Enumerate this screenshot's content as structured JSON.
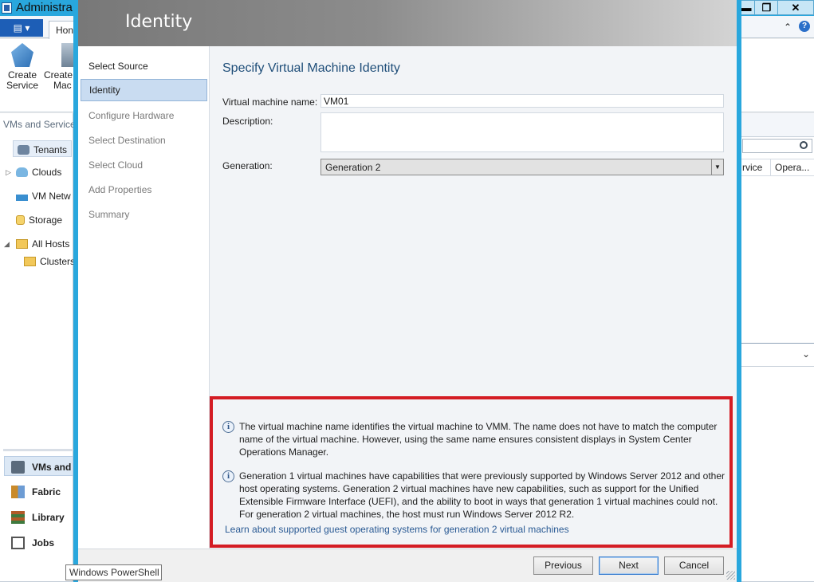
{
  "main_window": {
    "title": "Administra",
    "window_buttons": {
      "minimize": "▬",
      "restore": "❐",
      "close": "✕"
    },
    "file_menu": "▤ ▾",
    "tab_home": "Hon",
    "ribbon_collapse": "⌃",
    "ribbon_help": "?",
    "ribbon_buttons": {
      "create_service": [
        "Create",
        "Service"
      ],
      "create_vm": [
        "Create",
        "Mac"
      ]
    },
    "nav": {
      "header": "VMs and Service",
      "items": {
        "tenants": "Tenants",
        "clouds": "Clouds",
        "vm_networks": "VM Netw",
        "storage": "Storage",
        "all_hosts": "All Hosts",
        "clusters": "Clusters"
      },
      "workspaces": {
        "vms": "VMs and",
        "fabric": "Fabric",
        "library": "Library",
        "jobs": "Jobs"
      }
    },
    "grid_columns": {
      "service": "rvice",
      "operating": "Opera..."
    }
  },
  "wizard": {
    "header_title": "Identity",
    "steps": [
      {
        "label": "Select Source"
      },
      {
        "label": "Identity"
      },
      {
        "label": "Configure Hardware"
      },
      {
        "label": "Select Destination"
      },
      {
        "label": "Select Cloud"
      },
      {
        "label": "Add Properties"
      },
      {
        "label": "Summary"
      }
    ],
    "page_title": "Specify Virtual Machine Identity",
    "fields": {
      "vm_name_label": "Virtual machine name:",
      "vm_name_value": "VM01",
      "description_label": "Description:",
      "description_value": "",
      "generation_label": "Generation:",
      "generation_value": "Generation 2"
    },
    "info": {
      "icon": "i",
      "para1_lines": [
        "The virtual machine name identifies the virtual machine to VMM. The name does not have to match the computer",
        "name of the virtual machine. However, using the same name ensures consistent displays in System Center",
        "Operations Manager."
      ],
      "para2_lines": [
        "Generation 1 virtual machines have capabilities that were previously supported by Windows Server 2012 and other",
        "host operating systems. Generation 2 virtual machines have new capabilities, such as support for the Unified",
        "Extensible Firmware Interface (UEFI), and the ability to boot in ways that generation 1 virtual machines could not.",
        "For generation 2 virtual machines, the host must run Windows Server 2012 R2."
      ],
      "link": "Learn about supported guest operating systems for generation 2 virtual machines"
    },
    "buttons": {
      "previous": "Previous",
      "next": "Next",
      "cancel": "Cancel"
    }
  },
  "tooltip": "Windows PowerShell",
  "colors": {
    "accent": "#29a7dd",
    "highlight_box": "#d41c24",
    "active_step": "#c9dcf1"
  }
}
